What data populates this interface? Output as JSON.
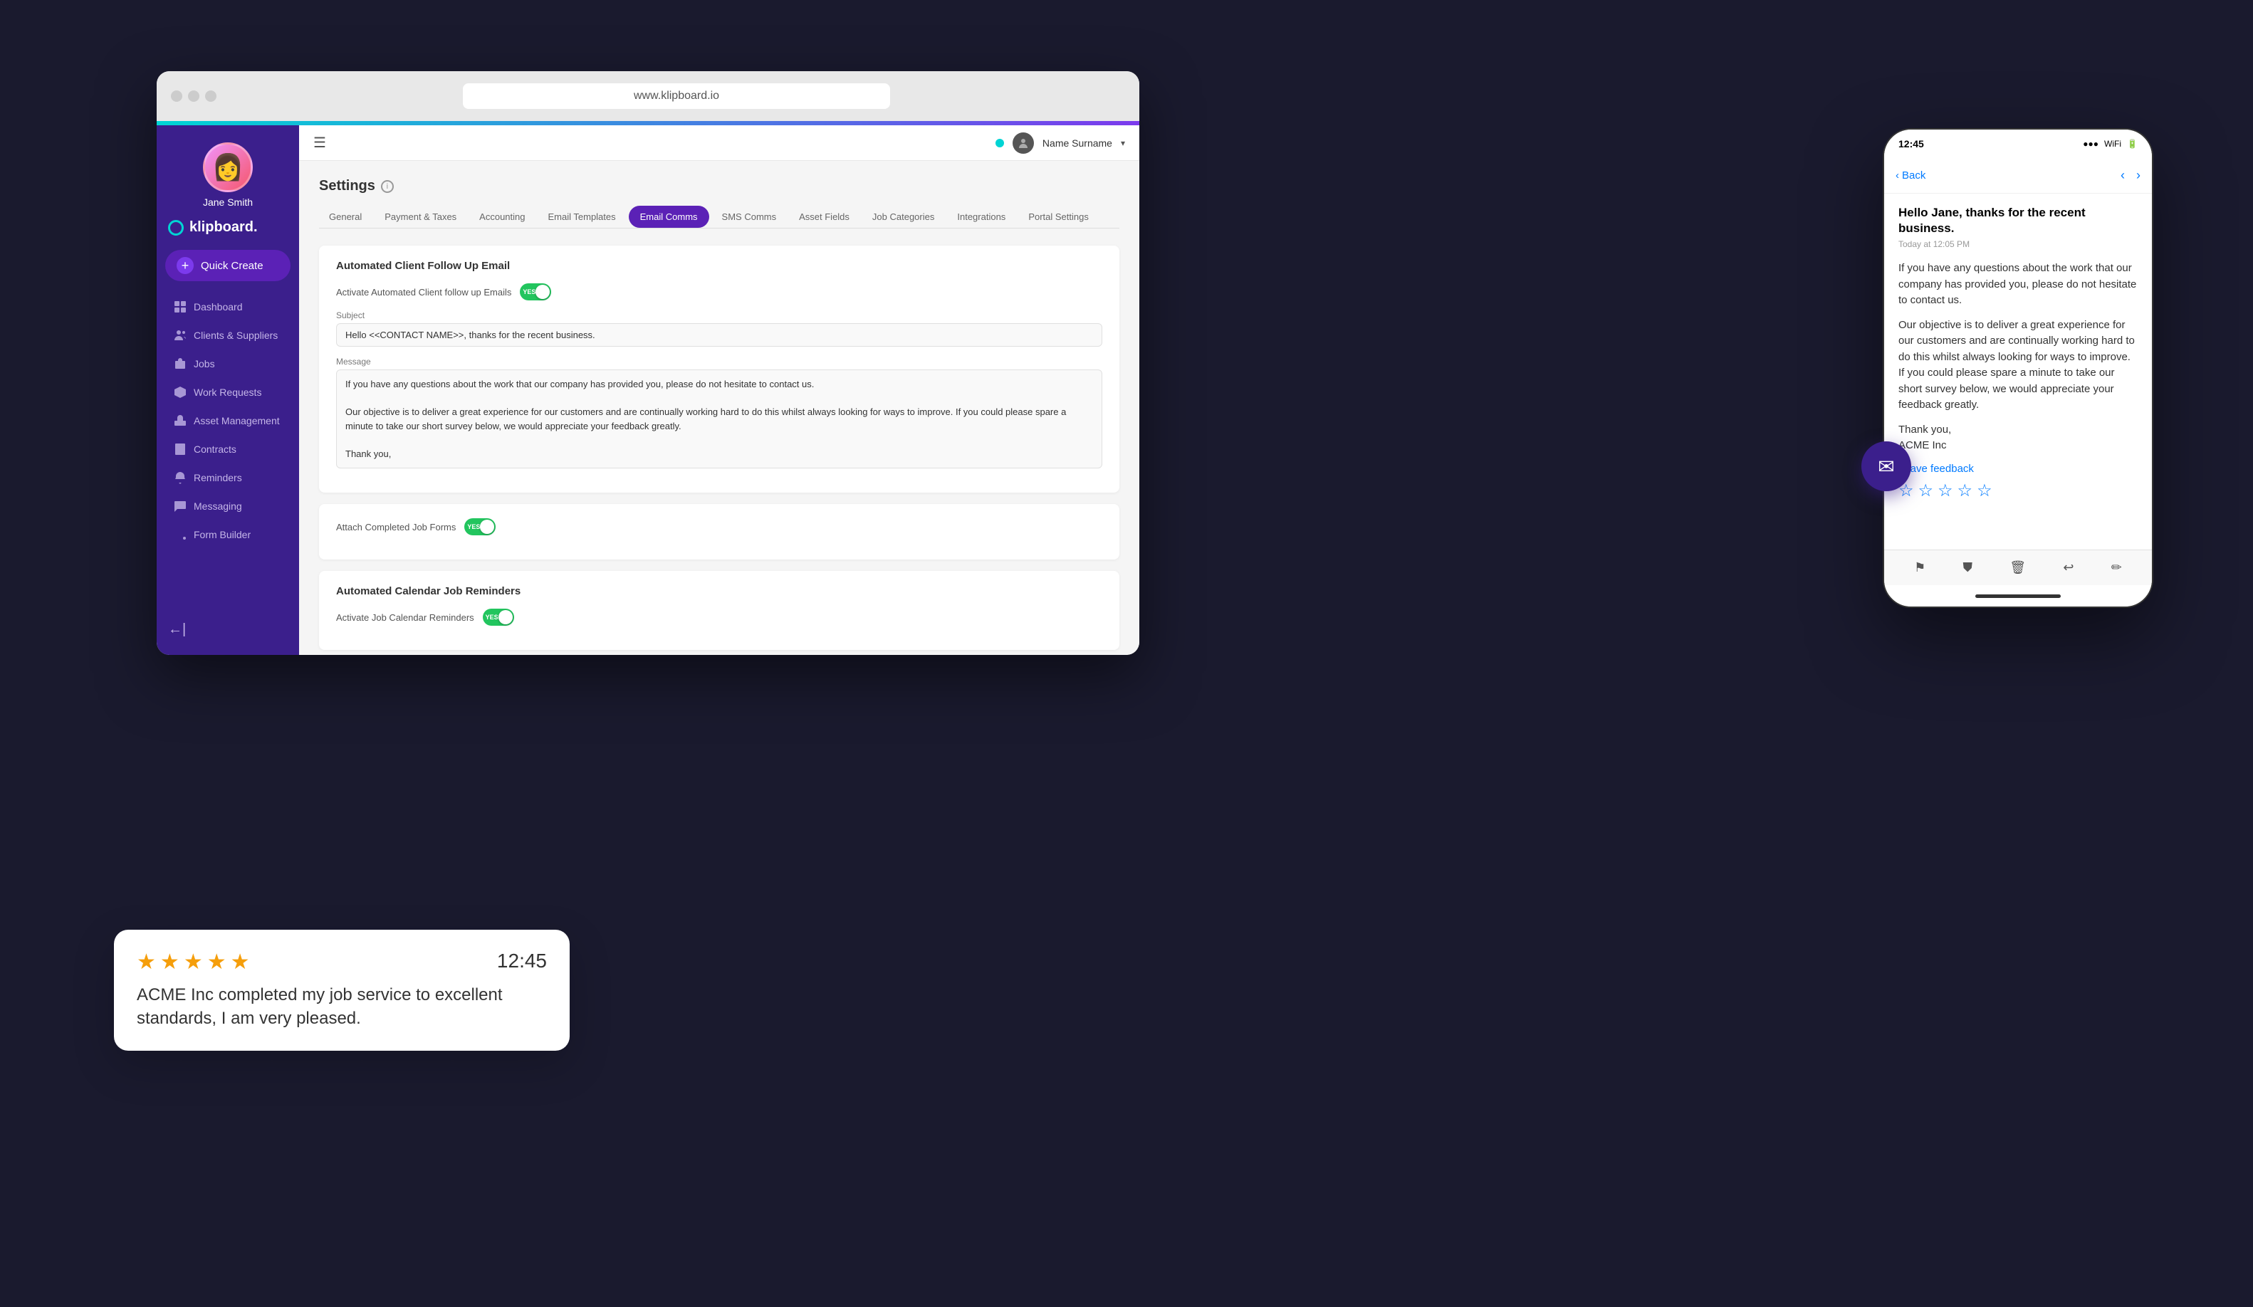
{
  "browser": {
    "address": "www.klipboard.io"
  },
  "sidebar": {
    "logo": "klipboard.",
    "quickCreate": "Quick Create",
    "user": {
      "name": "Jane Smith"
    },
    "navItems": [
      {
        "label": "Dashboard",
        "icon": "dashboard"
      },
      {
        "label": "Clients & Suppliers",
        "icon": "clients"
      },
      {
        "label": "Jobs",
        "icon": "jobs"
      },
      {
        "label": "Work Requests",
        "icon": "work-requests"
      },
      {
        "label": "Asset Management",
        "icon": "asset"
      },
      {
        "label": "Contracts",
        "icon": "contracts"
      },
      {
        "label": "Reminders",
        "icon": "reminders"
      },
      {
        "label": "Messaging",
        "icon": "messaging"
      },
      {
        "label": "Form Builder",
        "icon": "form-builder"
      }
    ],
    "collapseLabel": "←|"
  },
  "topBar": {
    "userName": "Name Surname"
  },
  "settings": {
    "title": "Settings",
    "tabs": [
      {
        "label": "General",
        "active": false
      },
      {
        "label": "Payment & Taxes",
        "active": false
      },
      {
        "label": "Accounting",
        "active": false
      },
      {
        "label": "Email Templates",
        "active": false
      },
      {
        "label": "Email Comms",
        "active": true
      },
      {
        "label": "SMS Comms",
        "active": false
      },
      {
        "label": "Asset Fields",
        "active": false
      },
      {
        "label": "Job Categories",
        "active": false
      },
      {
        "label": "Integrations",
        "active": false
      },
      {
        "label": "Portal Settings",
        "active": false
      }
    ],
    "autoFollowUp": {
      "sectionTitle": "Automated Client Follow Up Email",
      "toggleLabel": "Activate Automated Client follow up Emails",
      "toggleValue": "YES",
      "subjectLabel": "Subject",
      "subjectValue": "Hello <<CONTACT NAME>>, thanks for the recent business.",
      "messageLabel": "Message",
      "messageValue": "If you have any questions about the work that our company has provided you, please do not hesitate to contact us.\n\nOur objective is to deliver a great experience for our customers and are continually working hard to do this whilst always looking for ways to improve. If you could please spare a minute to take our short survey below, we would appreciate your feedback greatly.\n\nThank you,"
    },
    "attachForms": {
      "toggleLabel": "Attach Completed Job Forms",
      "toggleValue": "YES"
    },
    "calendarReminders": {
      "sectionTitle": "Automated Calendar Job Reminders",
      "toggleLabel": "Activate Job Calendar Reminders",
      "toggleValue": "YES"
    }
  },
  "phone": {
    "time": "12:45",
    "backLabel": "Back",
    "greeting": "Hello Jane, thanks for the recent business.",
    "timestamp": "Today at 12:05 PM",
    "messages": [
      "If you have any questions about the work that our company has provided you, please do not hesitate to contact us.",
      "Our objective is to deliver a great experience for our customers and are continually working hard to do this whilst always looking for ways to improve. If you could please spare a minute to take our short survey below, we would appreciate your feedback greatly.",
      "Thank you,\nACME Inc"
    ],
    "leaveFeedback": "Leave feedback",
    "stars": [
      "☆",
      "☆",
      "☆",
      "☆",
      "☆"
    ]
  },
  "ratingCard": {
    "stars": [
      "★",
      "★",
      "★",
      "★",
      "★"
    ],
    "time": "12:45",
    "text": "ACME Inc completed my job service to excellent standards, I am very pleased."
  }
}
